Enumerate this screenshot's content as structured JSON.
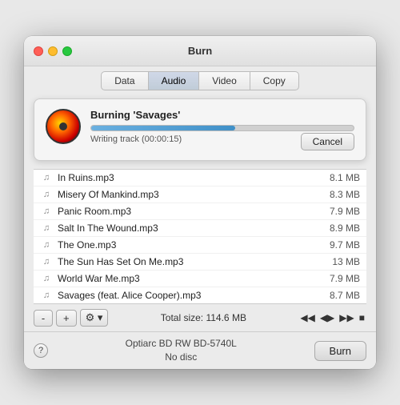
{
  "window": {
    "title": "Burn"
  },
  "tabs": [
    {
      "label": "Data",
      "active": false
    },
    {
      "label": "Audio",
      "active": true
    },
    {
      "label": "Video",
      "active": false
    },
    {
      "label": "Copy",
      "active": false
    }
  ],
  "burn_overlay": {
    "title": "Burning 'Savages'",
    "status": "Writing track (00:00:15)",
    "progress_percent": 55,
    "cancel_label": "Cancel"
  },
  "files": [
    {
      "name": "In Ruins.mp3",
      "size": "8.1 MB"
    },
    {
      "name": "Misery Of Mankind.mp3",
      "size": "8.3 MB"
    },
    {
      "name": "Panic Room.mp3",
      "size": "7.9 MB"
    },
    {
      "name": "Salt In The Wound.mp3",
      "size": "8.9 MB"
    },
    {
      "name": "The One.mp3",
      "size": "9.7 MB"
    },
    {
      "name": "The Sun Has Set On Me.mp3",
      "size": "13 MB"
    },
    {
      "name": "World War Me.mp3",
      "size": "7.9 MB"
    },
    {
      "name": "Savages (feat. Alice Cooper).mp3",
      "size": "8.7 MB"
    }
  ],
  "toolbar": {
    "minus_label": "-",
    "plus_label": "+",
    "gear_label": "⚙ ▾",
    "total_size": "Total size: 114.6 MB"
  },
  "playback": {
    "rewind": "◀◀",
    "skip_back": "◀▶",
    "play": "▶▶",
    "stop": "■"
  },
  "drive_bar": {
    "help_label": "?",
    "drive_name": "Optiarc BD RW BD-5740L",
    "disc_status": "No disc",
    "burn_label": "Burn"
  }
}
